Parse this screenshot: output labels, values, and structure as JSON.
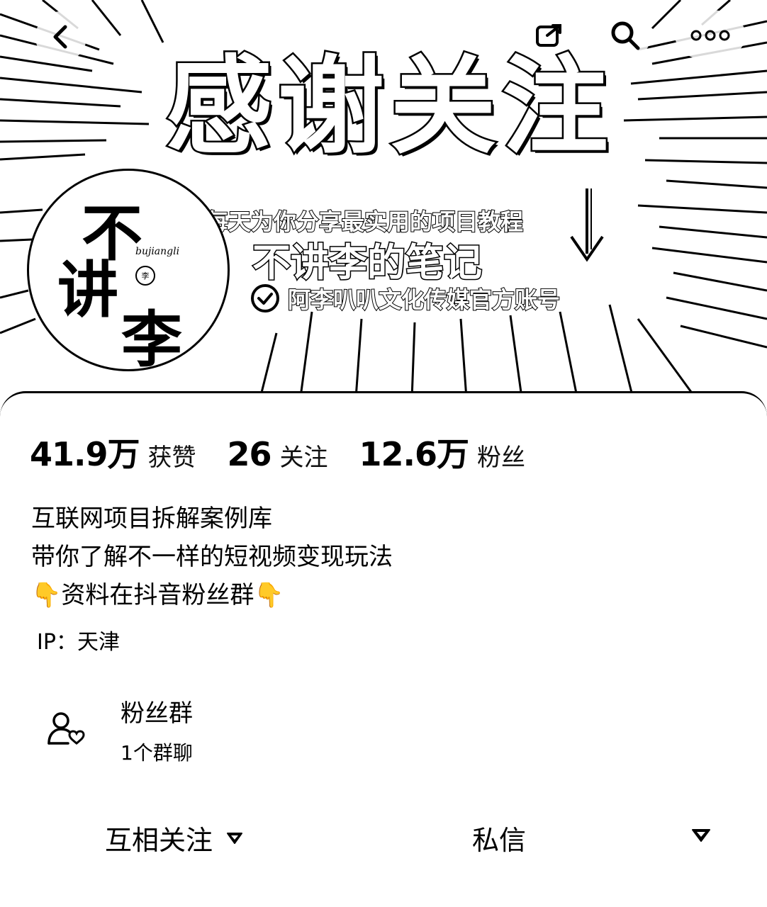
{
  "banner": {
    "title": "感谢关注",
    "tagline": "每天为你分享最实用的项目教程",
    "channel_name": "不讲李的笔记",
    "verified_text": "阿李叭叭文化传媒官方账号"
  },
  "avatar": {
    "char1": "不",
    "char2": "讲",
    "char3": "李",
    "pinyin": "bujiangli",
    "seal": "李"
  },
  "nav": {
    "back_icon": "back-chevron-icon",
    "share_icon": "share-icon",
    "search_icon": "search-icon",
    "more_icon": "more-dots-icon"
  },
  "stats": [
    {
      "value": "41.9万",
      "label": "获赞"
    },
    {
      "value": "26",
      "label": "关注"
    },
    {
      "value": "12.6万",
      "label": "粉丝"
    }
  ],
  "bio": {
    "line1": "互联网项目拆解案例库",
    "line2": "带你了解不一样的短视频变现玩法",
    "line3": "👇资料在抖音粉丝群👇"
  },
  "ip": "IP：天津",
  "fan_group": {
    "title": "粉丝群",
    "subtitle": "1个群聊"
  },
  "actions": {
    "follow_label": "互相关注",
    "message_label": "私信"
  }
}
